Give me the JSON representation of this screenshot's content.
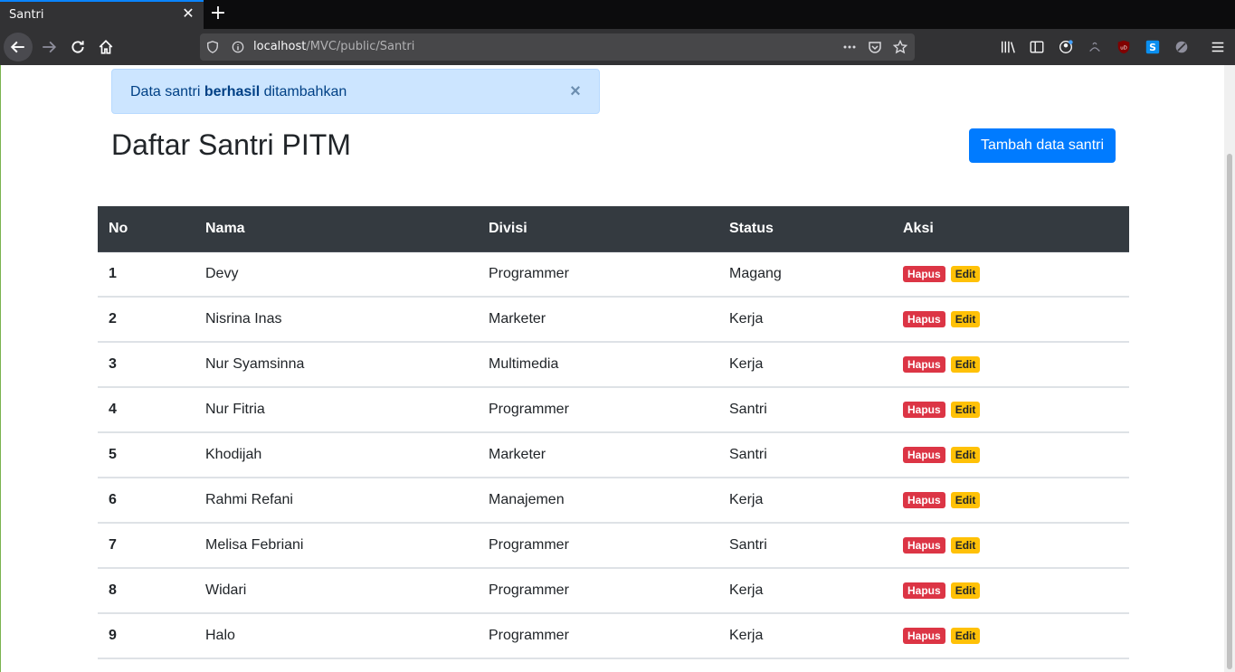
{
  "browser": {
    "tab_title": "Santri",
    "tab_close": "✕",
    "new_tab": "+",
    "url_host": "localhost",
    "url_path": "/MVC/public/Santri"
  },
  "alert": {
    "text_before": "Data santri ",
    "text_bold": "berhasil",
    "text_after": " ditambahkan",
    "close": "×"
  },
  "page": {
    "title": "Daftar Santri PITM",
    "add_button": "Tambah data santri"
  },
  "table": {
    "headers": [
      "No",
      "Nama",
      "Divisi",
      "Status",
      "Aksi"
    ],
    "rows": [
      {
        "no": "1",
        "nama": "Devy",
        "divisi": "Programmer",
        "status": "Magang"
      },
      {
        "no": "2",
        "nama": "Nisrina Inas",
        "divisi": "Marketer",
        "status": "Kerja"
      },
      {
        "no": "3",
        "nama": "Nur Syamsinna",
        "divisi": "Multimedia",
        "status": "Kerja"
      },
      {
        "no": "4",
        "nama": "Nur Fitria",
        "divisi": "Programmer",
        "status": "Santri"
      },
      {
        "no": "5",
        "nama": "Khodijah",
        "divisi": "Marketer",
        "status": "Santri"
      },
      {
        "no": "6",
        "nama": "Rahmi Refani",
        "divisi": "Manajemen",
        "status": "Kerja"
      },
      {
        "no": "7",
        "nama": "Melisa Febriani",
        "divisi": "Programmer",
        "status": "Santri"
      },
      {
        "no": "8",
        "nama": "Widari",
        "divisi": "Programmer",
        "status": "Kerja"
      },
      {
        "no": "9",
        "nama": "Halo",
        "divisi": "Programmer",
        "status": "Kerja"
      }
    ],
    "delete_label": "Hapus",
    "edit_label": "Edit"
  },
  "colors": {
    "primary": "#007bff",
    "danger": "#dc3545",
    "warning": "#ffc107",
    "table_head": "#343a40",
    "alert_bg": "#cce5ff"
  }
}
